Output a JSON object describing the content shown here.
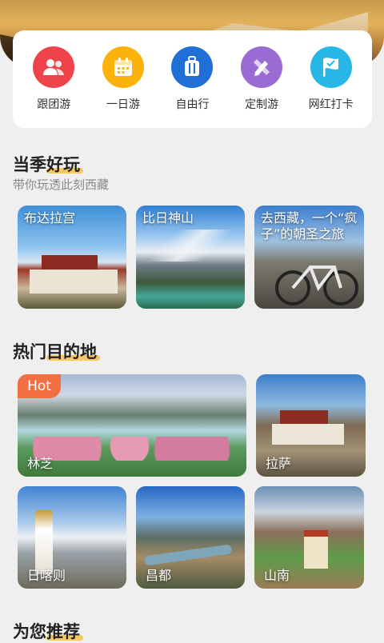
{
  "quick_nav": [
    {
      "label": "跟团游",
      "icon": "group-people-icon",
      "color": "#f0424b"
    },
    {
      "label": "一日游",
      "icon": "calendar-icon",
      "color": "#fbb20a"
    },
    {
      "label": "自由行",
      "icon": "luggage-icon",
      "color": "#1f6fd6"
    },
    {
      "label": "定制游",
      "icon": "pencil-icon",
      "color": "#9b6bd4"
    },
    {
      "label": "网红打卡",
      "icon": "flag-icon",
      "color": "#26b7e7"
    }
  ],
  "seasonal": {
    "title": "当季好玩",
    "subtitle": "带你玩透此刻西藏",
    "cards": [
      {
        "caption": "布达拉宫"
      },
      {
        "caption": "比日神山"
      },
      {
        "caption": "去西藏，一个“疯子”的朝圣之旅"
      }
    ]
  },
  "destinations": {
    "title": "热门目的地",
    "hot_badge": "Hot",
    "cards": [
      {
        "caption": "林芝"
      },
      {
        "caption": "拉萨"
      },
      {
        "caption": "日喀则"
      },
      {
        "caption": "昌都"
      },
      {
        "caption": "山南"
      }
    ]
  },
  "recommend": {
    "title": "为您推荐"
  }
}
